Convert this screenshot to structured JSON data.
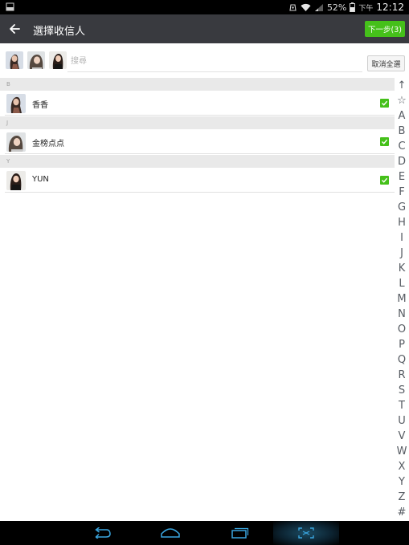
{
  "status_bar": {
    "battery_percent": "52%",
    "period": "下午",
    "time": "12:12",
    "icons": [
      "screenshot-icon",
      "rotation-lock-icon",
      "wifi-icon",
      "signal-icon",
      "battery-icon"
    ]
  },
  "app_bar": {
    "title": "選擇收信人",
    "next_button": "下一步(3)"
  },
  "selection": {
    "avatars": [
      "avatar-1",
      "avatar-2",
      "avatar-3"
    ],
    "search_placeholder": "搜尋",
    "deselect_all": "取消全選"
  },
  "sections": [
    {
      "letter": "B",
      "contacts": [
        {
          "name": "香香",
          "checked": true
        }
      ]
    },
    {
      "letter": "J",
      "contacts": [
        {
          "name": "金榜点点",
          "checked": true
        }
      ]
    },
    {
      "letter": "Y",
      "contacts": [
        {
          "name": "YUN",
          "checked": true
        }
      ]
    }
  ],
  "index_bar": [
    "↑",
    "☆",
    "A",
    "B",
    "C",
    "D",
    "E",
    "F",
    "G",
    "H",
    "I",
    "J",
    "K",
    "L",
    "M",
    "N",
    "O",
    "P",
    "Q",
    "R",
    "S",
    "T",
    "U",
    "V",
    "W",
    "X",
    "Y",
    "Z",
    "#"
  ],
  "colors": {
    "accent_green": "#45c01a",
    "app_bar": "#393a3f",
    "section_header": "#e9e9e9"
  },
  "nav_bar": {
    "buttons": [
      "back-nav-icon",
      "home-nav-icon",
      "recents-nav-icon",
      "screenshot-nav-icon"
    ]
  }
}
